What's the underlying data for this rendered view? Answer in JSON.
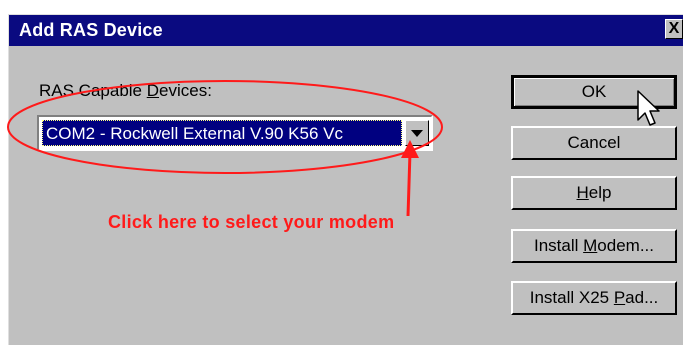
{
  "dialog": {
    "title": "Add RAS Device",
    "close_label": "X",
    "devices_label_prefix": "RAS Capable ",
    "devices_label_accel": "D",
    "devices_label_suffix": "evices:",
    "selected_device": "COM2 - Rockwell External V.90 K56 Vc"
  },
  "buttons": {
    "ok": "OK",
    "cancel": "Cancel",
    "help_accel": "H",
    "help_rest": "elp",
    "install_modem_prefix": "Install ",
    "install_modem_accel": "M",
    "install_modem_suffix": "odem...",
    "install_x25_prefix": "Install X25 ",
    "install_x25_accel": "P",
    "install_x25_suffix": "ad..."
  },
  "annotation": {
    "text": "Click here to select your modem",
    "color": "#ff1a1a"
  },
  "colors": {
    "titlebar": "#0a0a80",
    "face": "#c0c0c0",
    "selection": "#000080"
  },
  "icons": {
    "cursor": "mouse-pointer-icon",
    "dropdown": "chevron-down-icon",
    "close": "close-icon"
  }
}
